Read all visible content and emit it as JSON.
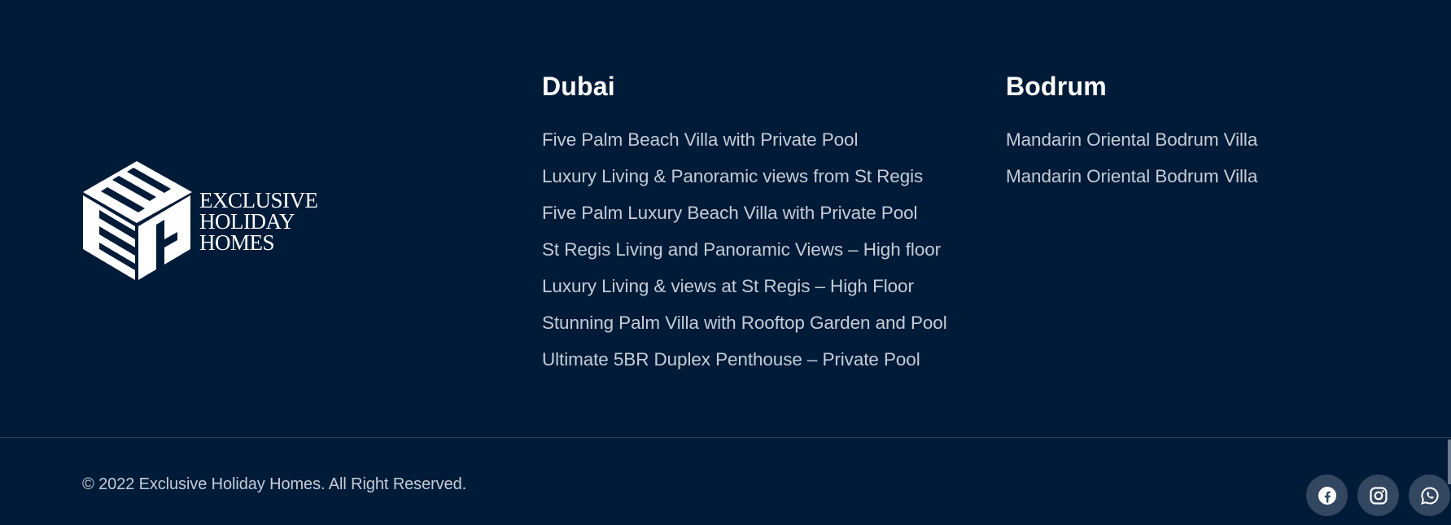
{
  "brand": {
    "logo_monogram": "EH",
    "logo_lines": [
      "EXCLUSIVE",
      "HOLIDAY",
      "HOMES"
    ]
  },
  "columns": [
    {
      "title": "Dubai",
      "links": [
        "Five Palm Beach Villa with Private Pool",
        "Luxury Living & Panoramic views from St Regis",
        "Five Palm Luxury Beach Villa with Private Pool",
        "St Regis Living and Panoramic Views – High floor",
        "Luxury Living & views at St Regis – High Floor",
        "Stunning Palm Villa with Rooftop Garden and Pool",
        "Ultimate 5BR Duplex Penthouse – Private Pool"
      ]
    },
    {
      "title": "Bodrum",
      "links": [
        "Mandarin Oriental Bodrum Villa",
        "Mandarin Oriental Bodrum Villa"
      ]
    }
  ],
  "copyright": "© 2022 Exclusive Holiday Homes. All Right Reserved.",
  "social": [
    {
      "name": "facebook-icon"
    },
    {
      "name": "instagram-icon"
    },
    {
      "name": "whatsapp-icon"
    }
  ],
  "colors": {
    "background": "#001b38",
    "heading": "#ffffff",
    "link": "#c5ccd6",
    "social_bg": "#334761"
  }
}
